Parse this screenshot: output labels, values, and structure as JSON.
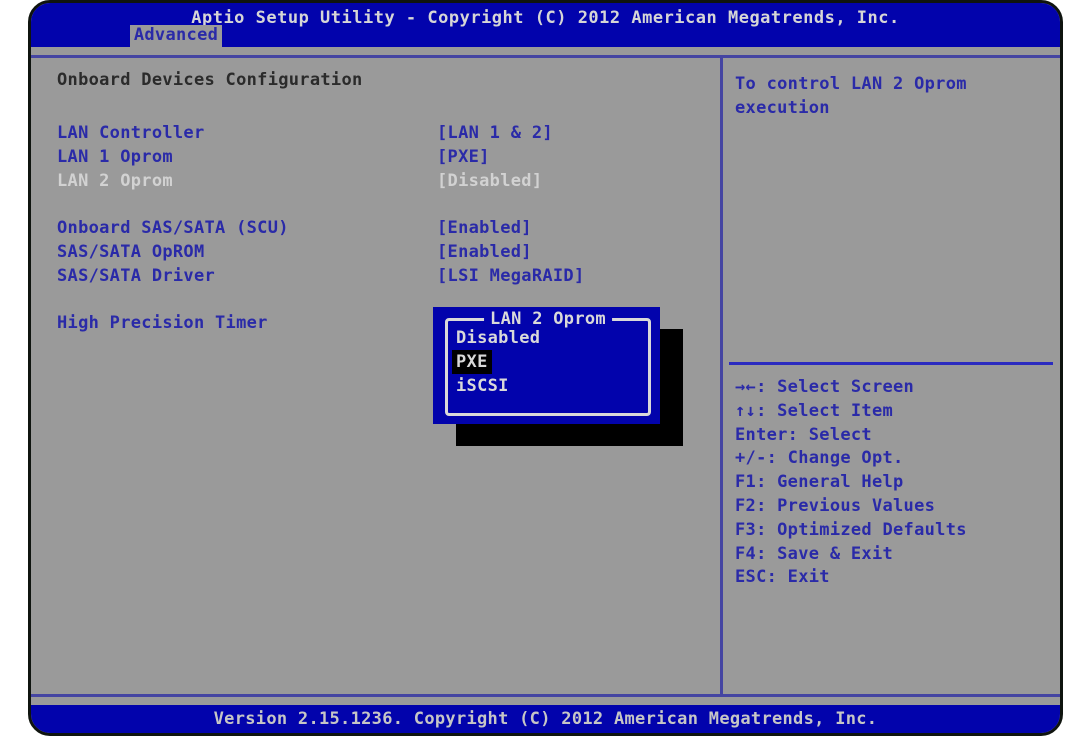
{
  "window": {
    "title": "Aptio Setup Utility - Copyright (C) 2012 American Megatrends, Inc.",
    "footer": "Version 2.15.1236. Copyright (C) 2012 American Megatrends, Inc."
  },
  "tabs": [
    {
      "label": "Advanced",
      "active": true
    }
  ],
  "main": {
    "section_title": "Onboard Devices Configuration",
    "groups": [
      [
        {
          "label": "LAN Controller",
          "value": "[LAN 1 & 2]",
          "selected": false
        },
        {
          "label": "LAN 1 Oprom",
          "value": "[PXE]",
          "selected": false
        },
        {
          "label": "LAN 2 Oprom",
          "value": "[Disabled]",
          "selected": true
        }
      ],
      [
        {
          "label": "Onboard SAS/SATA (SCU)",
          "value": "[Enabled]",
          "selected": false
        },
        {
          "label": "SAS/SATA OpROM",
          "value": "[Enabled]",
          "selected": false
        },
        {
          "label": "SAS/SATA Driver",
          "value": "[LSI MegaRAID]",
          "selected": false
        }
      ],
      [
        {
          "label": "High Precision Timer",
          "value": "",
          "selected": false
        }
      ]
    ]
  },
  "popup": {
    "title": "LAN 2 Oprom",
    "options": [
      {
        "label": "Disabled",
        "selected": false
      },
      {
        "label": "PXE",
        "selected": true
      },
      {
        "label": "iSCSI",
        "selected": false
      }
    ]
  },
  "help_panel": {
    "description": "To control LAN 2 Oprom execution",
    "keys": [
      {
        "key": "→←",
        "action": "Select Screen"
      },
      {
        "key": "↑↓",
        "action": "Select Item"
      },
      {
        "key": "Enter",
        "action": "Select"
      },
      {
        "key": "+/-",
        "action": "Change Opt."
      },
      {
        "key": "F1",
        "action": "General Help"
      },
      {
        "key": "F2",
        "action": "Previous Values"
      },
      {
        "key": "F3",
        "action": "Optimized Defaults"
      },
      {
        "key": "F4",
        "action": "Save & Exit"
      },
      {
        "key": "ESC",
        "action": "Exit"
      }
    ]
  },
  "colors": {
    "blue": "#0203ac",
    "gray-bg": "#9a9a9a",
    "label-blue": "#2a2aa8",
    "heading": "#2b2b2b",
    "selected-text": "#d2d2d2",
    "titlebar-text": "#d6d6d6",
    "footer-text": "#c6c6c6",
    "popup-border": "#d9d9d9",
    "highlight-bg": "#000000",
    "line-muted": "#4545a2",
    "line-bright": "#2b2bc0",
    "frame": "#0f140f"
  }
}
